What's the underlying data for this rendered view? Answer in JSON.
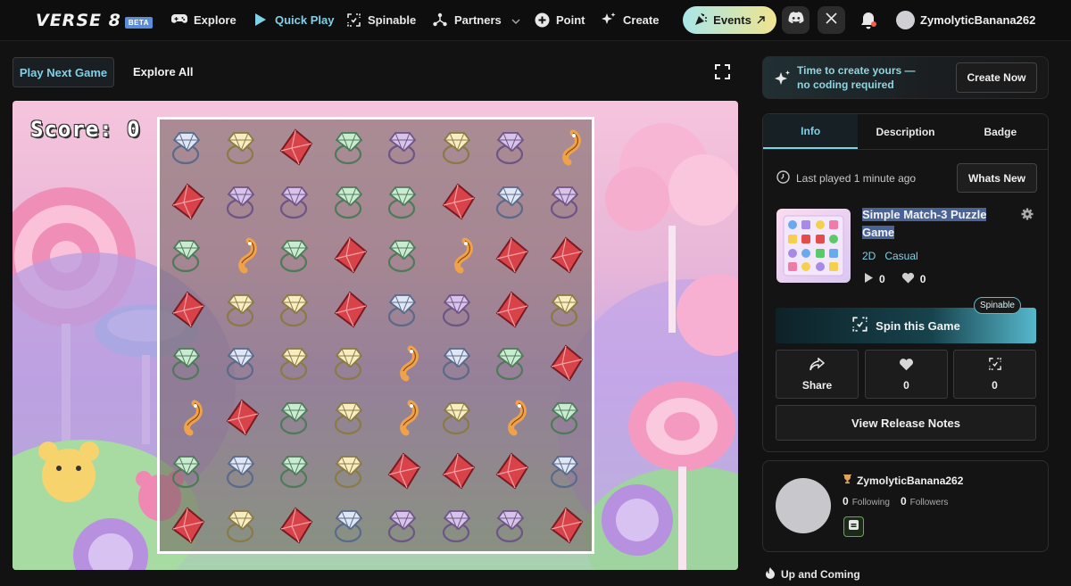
{
  "nav": {
    "logo": "VERSE 8",
    "logo_badge": "BETA",
    "items": [
      {
        "label": "Explore",
        "icon": "gamepad-icon"
      },
      {
        "label": "Quick Play",
        "icon": "play-icon"
      },
      {
        "label": "Spinable",
        "icon": "spin-icon"
      },
      {
        "label": "Partners",
        "icon": "partners-icon"
      },
      {
        "label": "Point",
        "icon": "plus-circle-icon"
      },
      {
        "label": "Create",
        "icon": "sparkle-icon"
      }
    ],
    "events_label": "Events",
    "username": "ZymolyticBanana262"
  },
  "toolbar": {
    "play_next": "Play Next Game",
    "explore_all": "Explore All"
  },
  "game": {
    "score_label": "Score: 0"
  },
  "promo": {
    "text": "Time to create yours — no coding required",
    "button": "Create Now"
  },
  "info": {
    "tabs": [
      "Info",
      "Description",
      "Badge"
    ],
    "last_played": "Last played 1 minute ago",
    "whats_new": "Whats New",
    "title": "Simple Match-3 Puzzle Game",
    "tags": [
      "2D",
      "Casual"
    ],
    "plays": "0",
    "likes": "0",
    "spin_label": "Spin this Game",
    "spinable_badge": "Spinable",
    "share_label": "Share",
    "like_count": "0",
    "remix_count": "0",
    "release_notes": "View Release Notes"
  },
  "creator": {
    "name": "ZymolyticBanana262",
    "following": "0",
    "following_label": "Following",
    "followers": "0",
    "followers_label": "Followers"
  },
  "section": {
    "up_and_coming": "Up and Coming"
  },
  "colors": {
    "accent": "#7fd1e8",
    "background": "#121212"
  }
}
